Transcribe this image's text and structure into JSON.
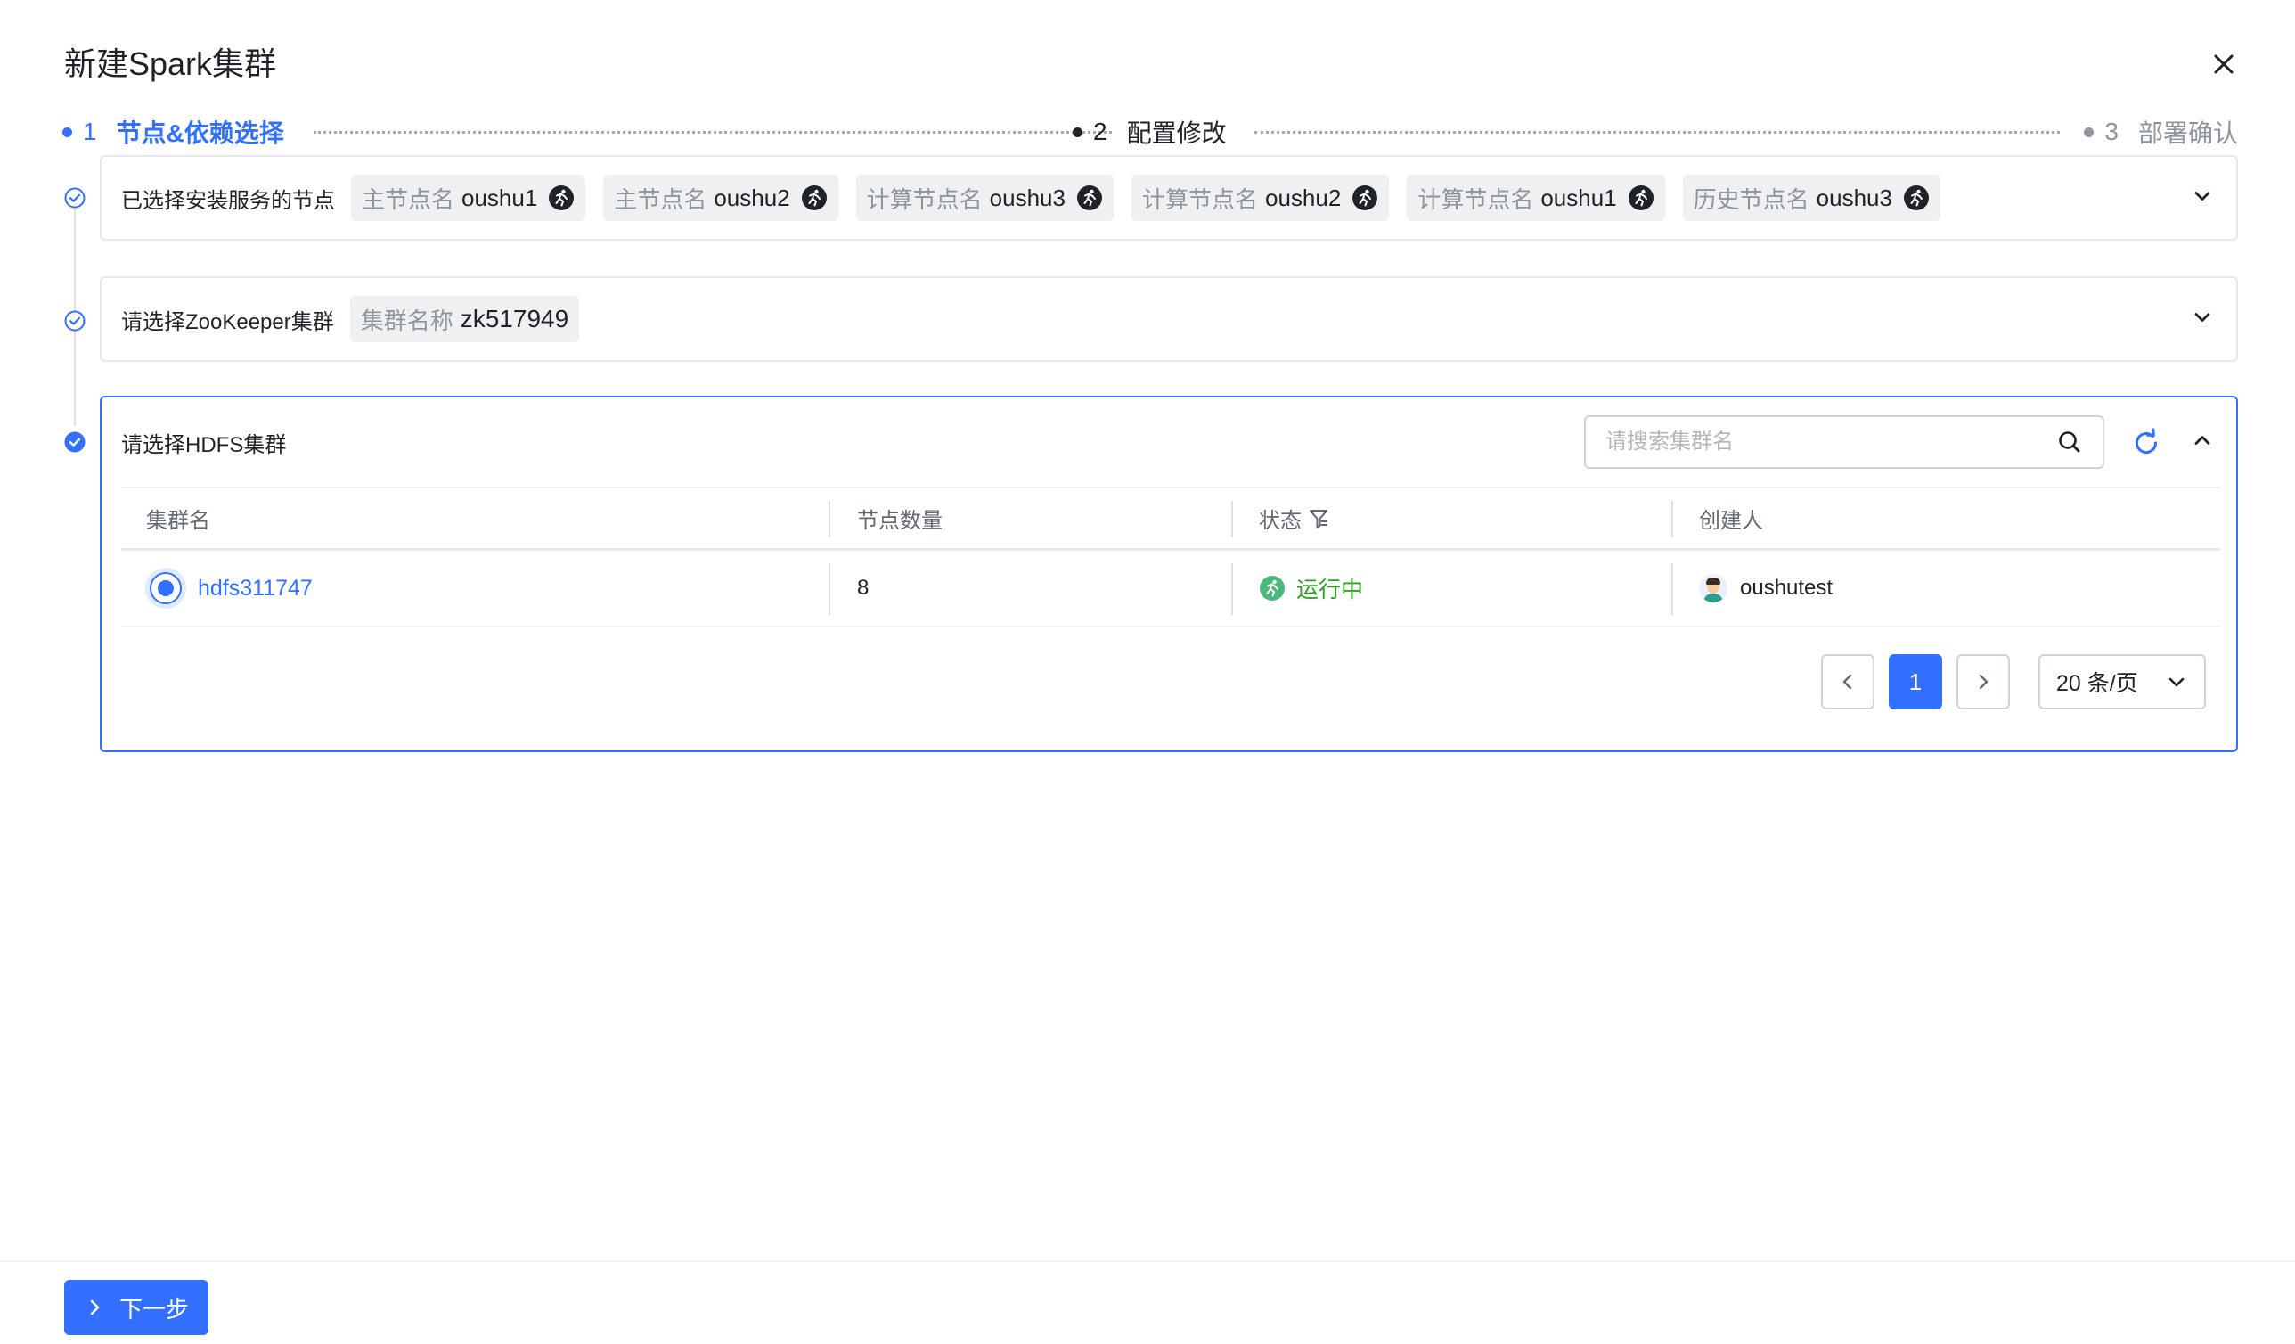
{
  "dialog": {
    "title": "新建Spark集群"
  },
  "steps": [
    {
      "num": "1",
      "label": "节点&依赖选择",
      "state": "active"
    },
    {
      "num": "2",
      "label": "配置修改",
      "state": "pending"
    },
    {
      "num": "3",
      "label": "部署确认",
      "state": "pending"
    }
  ],
  "nodes_card": {
    "label": "已选择安装服务的节点",
    "tags": [
      {
        "key": "主节点名",
        "value": "oushu1"
      },
      {
        "key": "主节点名",
        "value": "oushu2"
      },
      {
        "key": "计算节点名",
        "value": "oushu3"
      },
      {
        "key": "计算节点名",
        "value": "oushu2"
      },
      {
        "key": "计算节点名",
        "value": "oushu1"
      },
      {
        "key": "历史节点名",
        "value": "oushu3"
      }
    ]
  },
  "zk_card": {
    "label": "请选择ZooKeeper集群",
    "tag": {
      "key": "集群名称",
      "value": "zk517949"
    }
  },
  "hdfs_card": {
    "label": "请选择HDFS集群",
    "search_placeholder": "请搜索集群名",
    "columns": [
      "集群名",
      "节点数量",
      "状态",
      "创建人"
    ],
    "rows": [
      {
        "name": "hdfs311747",
        "nodes": "8",
        "status": "运行中",
        "creator": "oushutest"
      }
    ],
    "pagination": {
      "current": "1",
      "page_size": "20 条/页"
    }
  },
  "footer": {
    "next_label": "下一步"
  },
  "colors": {
    "primary": "#3370ff",
    "success": "#2ea121",
    "border": "#e6e8eb",
    "muted": "#8f959e"
  }
}
